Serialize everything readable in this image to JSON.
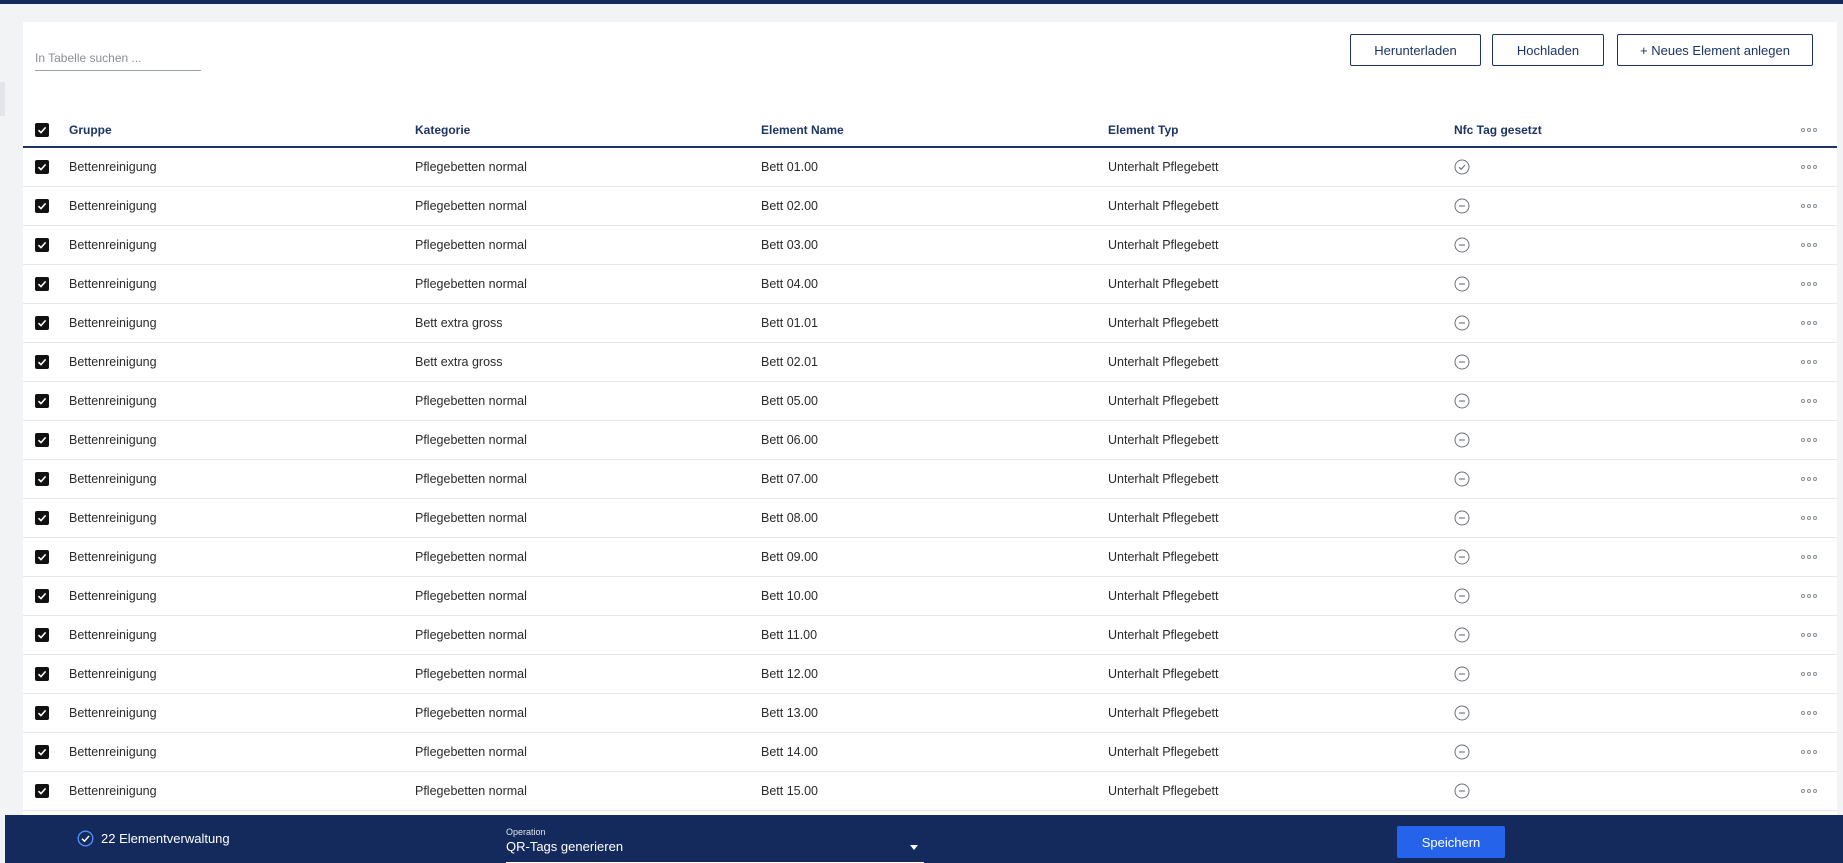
{
  "search": {
    "placeholder": "In Tabelle suchen ..."
  },
  "toolbar": {
    "download_label": "Herunterladen",
    "upload_label": "Hochladen",
    "new_label": "+ Neues Element anlegen"
  },
  "table": {
    "columns": [
      "Gruppe",
      "Kategorie",
      "Element Name",
      "Element Typ",
      "Nfc Tag gesetzt"
    ],
    "rows": [
      {
        "gruppe": "Bettenreinigung",
        "kategorie": "Pflegebetten normal",
        "name": "Bett 01.00",
        "typ": "Unterhalt Pflegebett",
        "nfc": "check-circle-icon"
      },
      {
        "gruppe": "Bettenreinigung",
        "kategorie": "Pflegebetten normal",
        "name": "Bett 02.00",
        "typ": "Unterhalt Pflegebett",
        "nfc": "minus-circle-icon"
      },
      {
        "gruppe": "Bettenreinigung",
        "kategorie": "Pflegebetten normal",
        "name": "Bett 03.00",
        "typ": "Unterhalt Pflegebett",
        "nfc": "minus-circle-icon"
      },
      {
        "gruppe": "Bettenreinigung",
        "kategorie": "Pflegebetten normal",
        "name": "Bett 04.00",
        "typ": "Unterhalt Pflegebett",
        "nfc": "minus-circle-icon"
      },
      {
        "gruppe": "Bettenreinigung",
        "kategorie": "Bett extra gross",
        "name": "Bett 01.01",
        "typ": "Unterhalt Pflegebett",
        "nfc": "minus-circle-icon"
      },
      {
        "gruppe": "Bettenreinigung",
        "kategorie": "Bett extra gross",
        "name": "Bett 02.01",
        "typ": "Unterhalt Pflegebett",
        "nfc": "minus-circle-icon"
      },
      {
        "gruppe": "Bettenreinigung",
        "kategorie": "Pflegebetten normal",
        "name": "Bett 05.00",
        "typ": "Unterhalt Pflegebett",
        "nfc": "minus-circle-icon"
      },
      {
        "gruppe": "Bettenreinigung",
        "kategorie": "Pflegebetten normal",
        "name": "Bett 06.00",
        "typ": "Unterhalt Pflegebett",
        "nfc": "minus-circle-icon"
      },
      {
        "gruppe": "Bettenreinigung",
        "kategorie": "Pflegebetten normal",
        "name": "Bett 07.00",
        "typ": "Unterhalt Pflegebett",
        "nfc": "minus-circle-icon"
      },
      {
        "gruppe": "Bettenreinigung",
        "kategorie": "Pflegebetten normal",
        "name": "Bett 08.00",
        "typ": "Unterhalt Pflegebett",
        "nfc": "minus-circle-icon"
      },
      {
        "gruppe": "Bettenreinigung",
        "kategorie": "Pflegebetten normal",
        "name": "Bett 09.00",
        "typ": "Unterhalt Pflegebett",
        "nfc": "minus-circle-icon"
      },
      {
        "gruppe": "Bettenreinigung",
        "kategorie": "Pflegebetten normal",
        "name": "Bett 10.00",
        "typ": "Unterhalt Pflegebett",
        "nfc": "minus-circle-icon"
      },
      {
        "gruppe": "Bettenreinigung",
        "kategorie": "Pflegebetten normal",
        "name": "Bett 11.00",
        "typ": "Unterhalt Pflegebett",
        "nfc": "minus-circle-icon"
      },
      {
        "gruppe": "Bettenreinigung",
        "kategorie": "Pflegebetten normal",
        "name": "Bett 12.00",
        "typ": "Unterhalt Pflegebett",
        "nfc": "minus-circle-icon"
      },
      {
        "gruppe": "Bettenreinigung",
        "kategorie": "Pflegebetten normal",
        "name": "Bett 13.00",
        "typ": "Unterhalt Pflegebett",
        "nfc": "minus-circle-icon"
      },
      {
        "gruppe": "Bettenreinigung",
        "kategorie": "Pflegebetten normal",
        "name": "Bett 14.00",
        "typ": "Unterhalt Pflegebett",
        "nfc": "minus-circle-icon"
      },
      {
        "gruppe": "Bettenreinigung",
        "kategorie": "Pflegebetten normal",
        "name": "Bett 15.00",
        "typ": "Unterhalt Pflegebett",
        "nfc": "minus-circle-icon"
      }
    ]
  },
  "footer": {
    "count_label": "22 Elementverwaltung",
    "operation_label": "Operation",
    "operation_value": "QR-Tags generieren",
    "save_label": "Speichern"
  },
  "colors": {
    "brand": "#142a5c",
    "accent": "#2563eb",
    "header_text": "#1c3466"
  }
}
